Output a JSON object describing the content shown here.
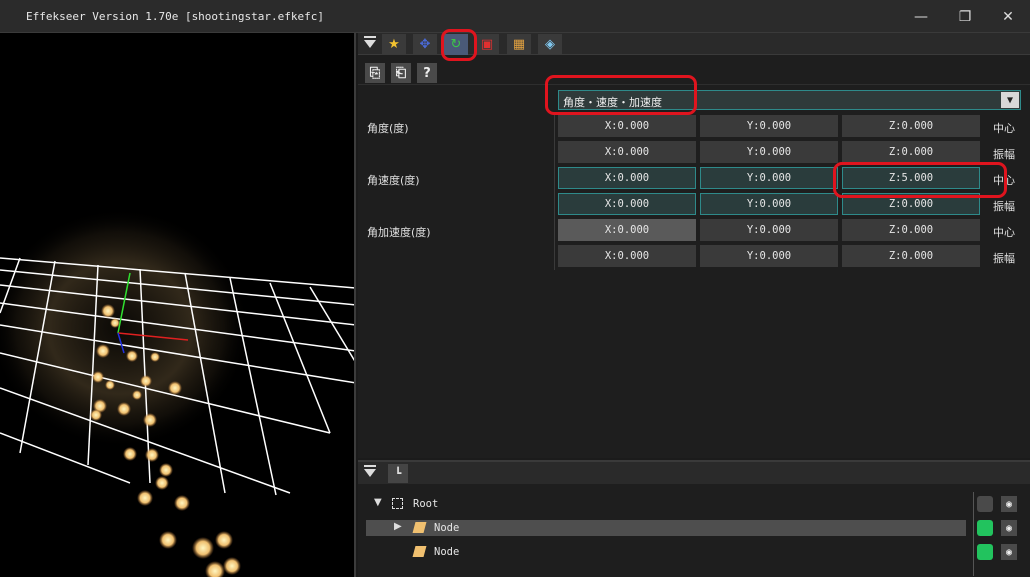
{
  "window": {
    "title": "Effekseer Version 1.70e [shootingstar.efkefc]",
    "minimize_icon": "minimize-icon",
    "maximize_icon": "restore-icon",
    "close_icon": "close-icon",
    "minimize_glyph": "—",
    "restore_glyph": "❐",
    "close_glyph": "✕"
  },
  "tabs": [
    {
      "name": "common",
      "icon": "star-icon",
      "glyph": "★"
    },
    {
      "name": "position",
      "icon": "move-icon",
      "glyph": "✥"
    },
    {
      "name": "rotation",
      "icon": "rotate-icon",
      "glyph": "↻"
    },
    {
      "name": "scale",
      "icon": "scale-icon",
      "glyph": "▣"
    },
    {
      "name": "draw",
      "icon": "box-icon",
      "glyph": "▦"
    },
    {
      "name": "render",
      "icon": "cube-icon",
      "glyph": "◈"
    }
  ],
  "tools": {
    "copy_glyph": "⎘",
    "paste_glyph": "⎗",
    "help_glyph": "?"
  },
  "rotation": {
    "mode": "角度・速度・加速度",
    "dropdown_arrow": "▼",
    "groups": [
      {
        "label": "角度(度)",
        "rows": [
          {
            "x": "X:0.000",
            "y": "Y:0.000",
            "z": "Z:0.000",
            "suffix": "中心"
          },
          {
            "x": "X:0.000",
            "y": "Y:0.000",
            "z": "Z:0.000",
            "suffix": "振幅"
          }
        ]
      },
      {
        "label": "角速度(度)",
        "rows": [
          {
            "x": "X:0.000",
            "y": "Y:0.000",
            "z": "Z:5.000",
            "suffix": "中心"
          },
          {
            "x": "X:0.000",
            "y": "Y:0.000",
            "z": "Z:0.000",
            "suffix": "振幅"
          }
        ]
      },
      {
        "label": "角加速度(度)",
        "rows": [
          {
            "x": "X:0.000",
            "y": "Y:0.000",
            "z": "Z:0.000",
            "suffix": "中心"
          },
          {
            "x": "X:0.000",
            "y": "Y:0.000",
            "z": "Z:0.000",
            "suffix": "振幅"
          }
        ]
      }
    ]
  },
  "node_tree": {
    "nodes": [
      {
        "label": "Root",
        "expander": "▼",
        "visible_color": "#4a4a4a"
      },
      {
        "label": "Node",
        "expander": "▶",
        "visible_color": "#22c35e"
      },
      {
        "label": "Node",
        "expander": "",
        "visible_color": "#22c35e"
      }
    ],
    "eye_glyph": "◉"
  },
  "colors": {
    "highlight": "#e0141e",
    "accent_teal": "#2e8a8a",
    "node_enabled": "#22c35e"
  }
}
